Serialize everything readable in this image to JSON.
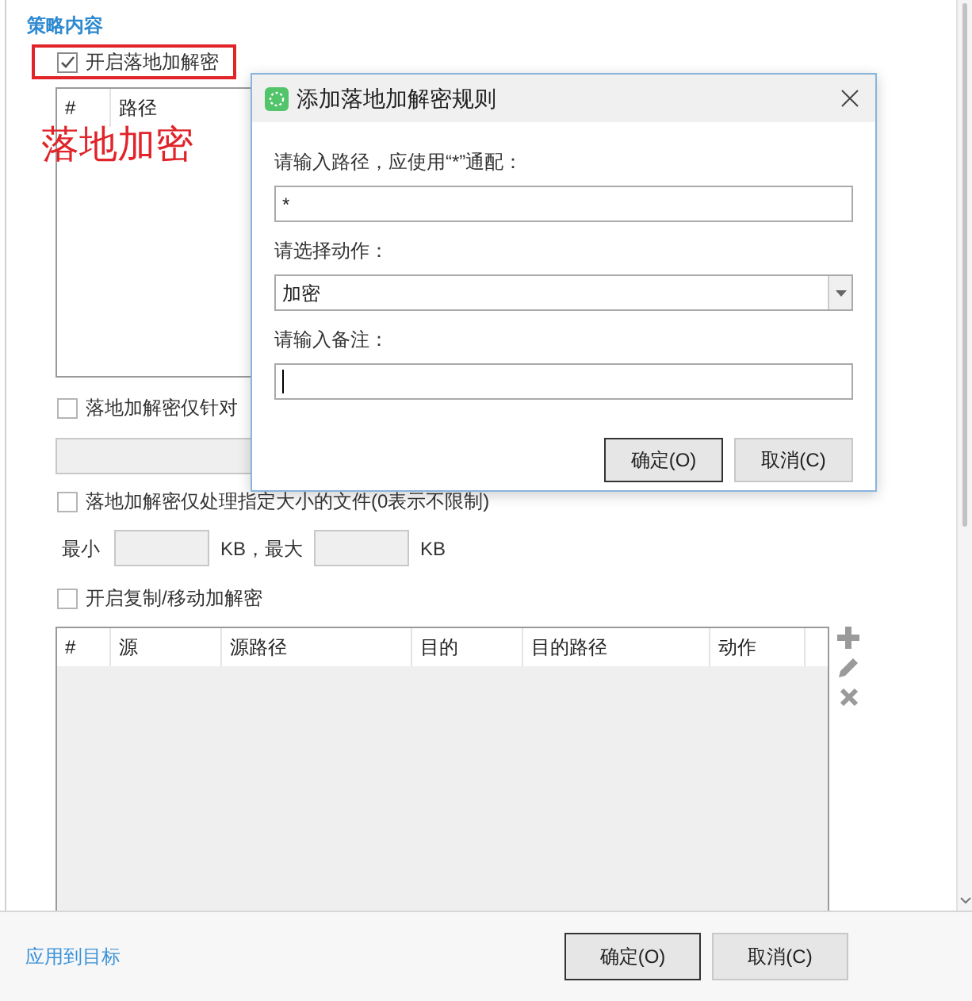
{
  "section_title": "策略内容",
  "enable_checkbox": {
    "label": "开启落地加解密",
    "checked": true
  },
  "annotation": {
    "label": "落地加密"
  },
  "path_table": {
    "columns": [
      "#",
      "路径"
    ]
  },
  "type_filter": {
    "label": "落地加解密仅针对",
    "checked": false
  },
  "size_filter": {
    "label": "落地加解密仅处理指定大小的文件(0表示不限制)",
    "checked": false,
    "min_label": "最小",
    "max_label": "KB，最大",
    "unit": "KB"
  },
  "copy_move": {
    "label": "开启复制/移动加解密",
    "checked": false
  },
  "rule_table": {
    "columns": [
      "#",
      "源",
      "源路径",
      "目的",
      "目的路径",
      "动作"
    ]
  },
  "footer": {
    "link": "应用到目标",
    "buttons": [
      {
        "label": "确定(O)",
        "default": true
      },
      {
        "label": "取消(C)",
        "default": false
      }
    ]
  },
  "dialog": {
    "title": "添加落地加解密规则",
    "fields": [
      {
        "kind": "text",
        "label": "请输入路径，应使用“*”通配：",
        "value": "*",
        "focused": false
      },
      {
        "kind": "select",
        "label": "请选择动作：",
        "value": "加密"
      },
      {
        "kind": "text",
        "label": "请输入备注：",
        "focused": true
      }
    ],
    "buttons": [
      {
        "label": "确定(O)",
        "default": true
      },
      {
        "label": "取消(C)",
        "default": false
      }
    ]
  }
}
